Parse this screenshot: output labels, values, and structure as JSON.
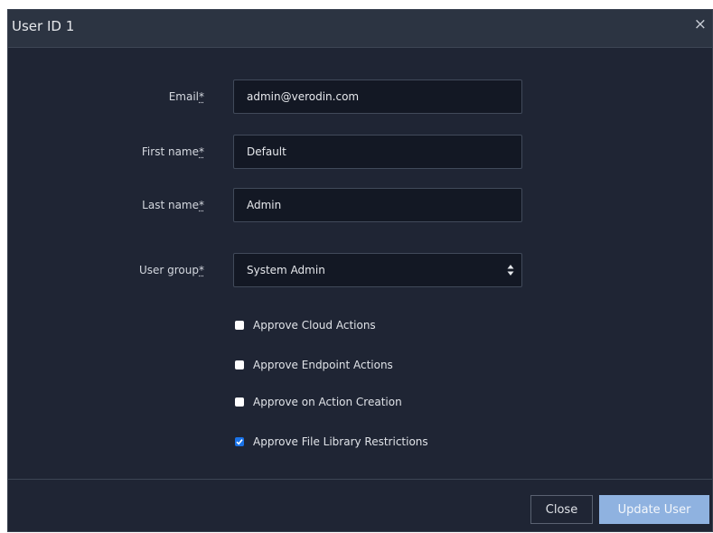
{
  "dialog": {
    "title": "User ID 1",
    "close_glyph": "×"
  },
  "form": {
    "email": {
      "label": "Email",
      "required_mark": "*",
      "value": "admin@verodin.com"
    },
    "first_name": {
      "label": "First name",
      "required_mark": "*",
      "value": "Default"
    },
    "last_name": {
      "label": "Last name",
      "required_mark": "*",
      "value": "Admin"
    },
    "user_group": {
      "label": "User group",
      "required_mark": "*",
      "selected": "System Admin",
      "icon": "select-arrows-icon"
    }
  },
  "checkboxes": [
    {
      "label": "Approve Cloud Actions",
      "checked": false
    },
    {
      "label": "Approve Endpoint Actions",
      "checked": false
    },
    {
      "label": "Approve on Action Creation",
      "checked": false
    },
    {
      "label": "Approve File Library Restrictions",
      "checked": true
    }
  ],
  "footer": {
    "close_label": "Close",
    "update_label": "Update User"
  },
  "colors": {
    "dialog_bg": "#1f2534",
    "header_bg": "#2c3442",
    "input_bg": "#131824",
    "primary_disabled": "#8fb2e0",
    "checkbox_checked": "#1a73e8"
  }
}
